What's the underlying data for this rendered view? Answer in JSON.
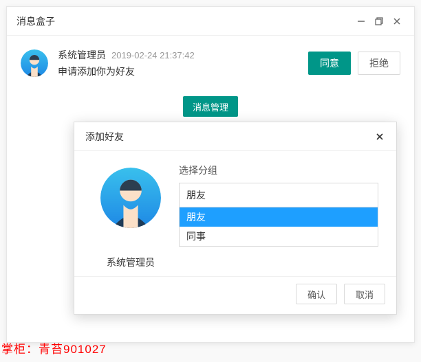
{
  "window": {
    "title": "消息盒子"
  },
  "message": {
    "sender": "系统管理员",
    "time": "2019-02-24 21:37:42",
    "content": "申请添加你为好友",
    "accept_label": "同意",
    "reject_label": "拒绝"
  },
  "manage_button": "消息管理",
  "dialog": {
    "title": "添加好友",
    "user_name": "系统管理员",
    "group_label": "选择分组",
    "selected_group": "朋友",
    "group_options": [
      "朋友",
      "同事"
    ],
    "selected_index": 0,
    "confirm_label": "确认",
    "cancel_label": "取消"
  },
  "watermark": "掌柜：青苔901027"
}
